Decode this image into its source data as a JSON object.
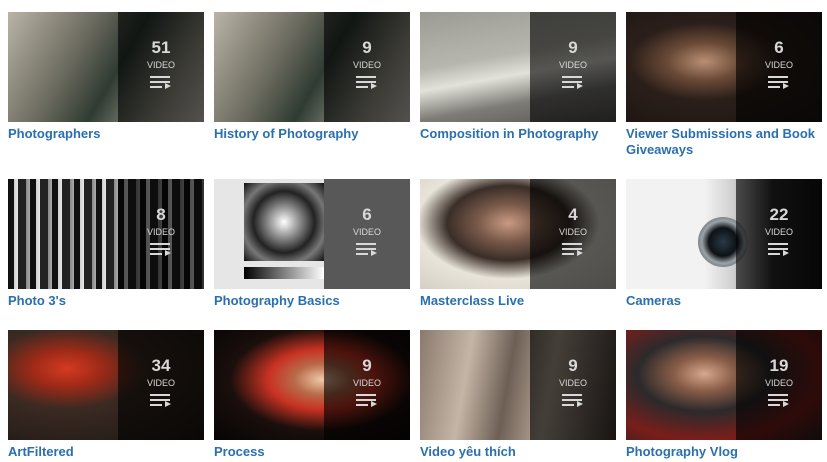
{
  "video_label": "VIDEO",
  "playlists": [
    {
      "title": "Photographers",
      "count": "51",
      "thumb": "photographers-thumbnail"
    },
    {
      "title": "History of Photography",
      "count": "9",
      "thumb": "history-of-photography-thumbnail"
    },
    {
      "title": "Composition in Photography",
      "count": "9",
      "thumb": "composition-thumbnail"
    },
    {
      "title": "Viewer Submissions and Book Giveaways",
      "count": "6",
      "thumb": "viewer-submissions-thumbnail"
    },
    {
      "title": "Photo 3's",
      "count": "8",
      "thumb": "photo-3s-thumbnail"
    },
    {
      "title": "Photography Basics",
      "count": "6",
      "thumb": "photography-basics-thumbnail"
    },
    {
      "title": "Masterclass Live",
      "count": "4",
      "thumb": "masterclass-live-thumbnail"
    },
    {
      "title": "Cameras",
      "count": "22",
      "thumb": "cameras-thumbnail"
    },
    {
      "title": "ArtFiltered",
      "count": "34",
      "thumb": "artfiltered-thumbnail"
    },
    {
      "title": "Process",
      "count": "9",
      "thumb": "process-thumbnail"
    },
    {
      "title": "Video yêu thích",
      "count": "9",
      "thumb": "favorite-videos-thumbnail"
    },
    {
      "title": "Photography Vlog",
      "count": "19",
      "thumb": "photography-vlog-thumbnail"
    }
  ]
}
